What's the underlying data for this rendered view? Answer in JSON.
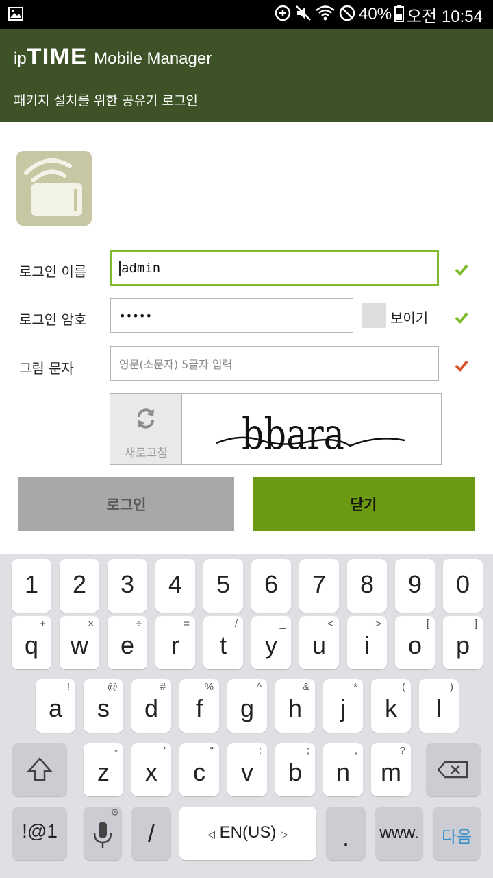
{
  "status_bar": {
    "battery_text": "40%",
    "time_text": "오전 10:54",
    "icons": [
      "gallery-icon",
      "data-saver-icon",
      "mute-icon",
      "wifi-icon",
      "blocked-icon",
      "battery-icon"
    ]
  },
  "header": {
    "brand_ip": "ip",
    "brand_time": "TIME",
    "brand_suffix": "Mobile Manager",
    "subtitle": "패키지 설치를 위한 공유기 로그인"
  },
  "form": {
    "username_label": "로그인 이름",
    "username_value": "admin",
    "password_label": "로그인 암호",
    "password_value": "•••••",
    "show_password_label": "보이기",
    "captcha_label": "그림 문자",
    "captcha_placeholder": "영문(소문자) 5글자 입력",
    "refresh_label": "새로고침",
    "captcha_text": "bbara"
  },
  "buttons": {
    "login": "로그인",
    "close": "닫기"
  },
  "colors": {
    "header_bg": "#3d5227",
    "accent_green": "#6c9a12",
    "focus_border": "#7dbb2c",
    "check_green": "#7dbb2c",
    "check_red": "#d9532b"
  },
  "keyboard": {
    "rows": [
      [
        {
          "k": "1"
        },
        {
          "k": "2"
        },
        {
          "k": "3"
        },
        {
          "k": "4"
        },
        {
          "k": "5"
        },
        {
          "k": "6"
        },
        {
          "k": "7"
        },
        {
          "k": "8"
        },
        {
          "k": "9"
        },
        {
          "k": "0"
        }
      ],
      [
        {
          "k": "q",
          "s": "+"
        },
        {
          "k": "w",
          "s": "×"
        },
        {
          "k": "e",
          "s": "÷"
        },
        {
          "k": "r",
          "s": "="
        },
        {
          "k": "t",
          "s": "/"
        },
        {
          "k": "y",
          "s": "_"
        },
        {
          "k": "u",
          "s": "<"
        },
        {
          "k": "i",
          "s": ">"
        },
        {
          "k": "o",
          "s": "["
        },
        {
          "k": "p",
          "s": "]"
        }
      ],
      [
        {
          "k": "a",
          "s": "!"
        },
        {
          "k": "s",
          "s": "@"
        },
        {
          "k": "d",
          "s": "#"
        },
        {
          "k": "f",
          "s": "%"
        },
        {
          "k": "g",
          "s": "^"
        },
        {
          "k": "h",
          "s": "&"
        },
        {
          "k": "j",
          "s": "*"
        },
        {
          "k": "k",
          "s": "("
        },
        {
          "k": "l",
          "s": ")"
        }
      ],
      [
        {
          "k": "z",
          "s": "-"
        },
        {
          "k": "x",
          "s": "'"
        },
        {
          "k": "c",
          "s": "\""
        },
        {
          "k": "v",
          "s": ":"
        },
        {
          "k": "b",
          "s": ";"
        },
        {
          "k": "n",
          "s": ","
        },
        {
          "k": "m",
          "s": "?"
        }
      ]
    ],
    "symbols_key": "!@1",
    "slash_key": "/",
    "space_label": "EN(US)",
    "period_key": ".",
    "www_key": "www.",
    "next_key": "다음",
    "next_color": "#3a8ec9"
  }
}
